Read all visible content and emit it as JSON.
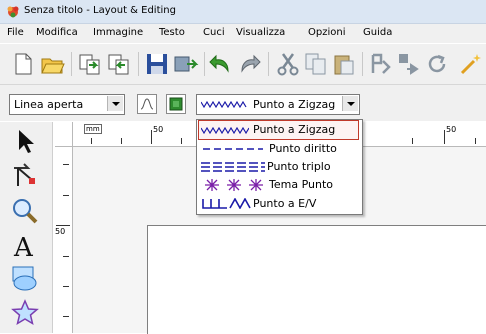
{
  "window": {
    "title": "Senza titolo - Layout & Editing"
  },
  "menu": [
    "File",
    "Modifica",
    "Immagine",
    "Testo",
    "Cuci",
    "Visualizza",
    "Opzioni",
    "Guida"
  ],
  "toolbar": {
    "icons": [
      "new-icon",
      "open-icon",
      "import-icon",
      "export-icon",
      "save-icon",
      "send-icon",
      "undo-icon",
      "redo-icon",
      "cut-icon",
      "copy-icon",
      "paste-icon",
      "stitch-icon",
      "flip-icon",
      "rotate-icon",
      "wizard-icon"
    ]
  },
  "properties": {
    "line_type": "Linea aperta",
    "stitch_type": "Punto a Zigzag"
  },
  "stitch_options": [
    {
      "label": "Punto a Zigzag",
      "selected": true
    },
    {
      "label": "Punto diritto",
      "selected": false
    },
    {
      "label": "Punto triplo",
      "selected": false
    },
    {
      "label": "Tema Punto",
      "selected": false
    },
    {
      "label": "Punto a E/V",
      "selected": false
    }
  ],
  "ruler": {
    "unit": "mm",
    "h_labels": [
      "50",
      "50"
    ],
    "v_labels": [
      "50"
    ]
  },
  "colors": {
    "accent": "#1a1aa8",
    "selection_border": "#c0392b"
  }
}
